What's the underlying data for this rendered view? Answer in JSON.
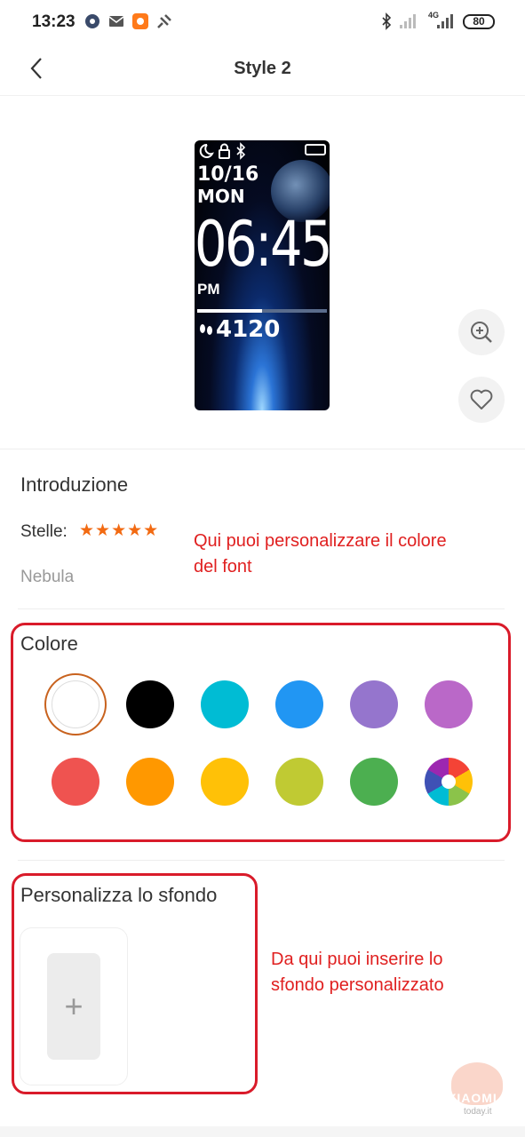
{
  "status_bar": {
    "time": "13:23",
    "network_label": "4G",
    "battery": "80"
  },
  "header": {
    "title": "Style 2",
    "back_icon": "chevron-left-icon"
  },
  "preview": {
    "date": "10/16",
    "day": "MON",
    "time": "06:45",
    "ampm": "PM",
    "steps": "4120",
    "progress": 0.5
  },
  "actions": {
    "zoom_icon": "zoom-in-icon",
    "favorite_icon": "heart-icon"
  },
  "intro": {
    "heading": "Introduzione",
    "stars_label": "Stelle:",
    "stars": "★★★★★",
    "stars_count": 5,
    "name": "Nebula"
  },
  "annotations": {
    "font_color_note_line1": "Qui puoi personalizzare il colore",
    "font_color_note_line2": "del font",
    "background_note_line1": "Da qui puoi inserire lo",
    "background_note_line2": "sfondo personalizzato"
  },
  "color": {
    "heading": "Colore",
    "swatches": [
      "#ffffff",
      "#000000",
      "#00bcd4",
      "#2196f3",
      "#9575cd",
      "#ba68c8",
      "#ef5350",
      "#ff9800",
      "#ffc107",
      "#c0ca33",
      "#4caf50",
      "multicolor"
    ],
    "selected": 0
  },
  "background": {
    "heading": "Personalizza lo sfondo",
    "add_symbol": "+"
  },
  "watermark": {
    "brand": "XIAOMI",
    "domain": "today.it"
  }
}
